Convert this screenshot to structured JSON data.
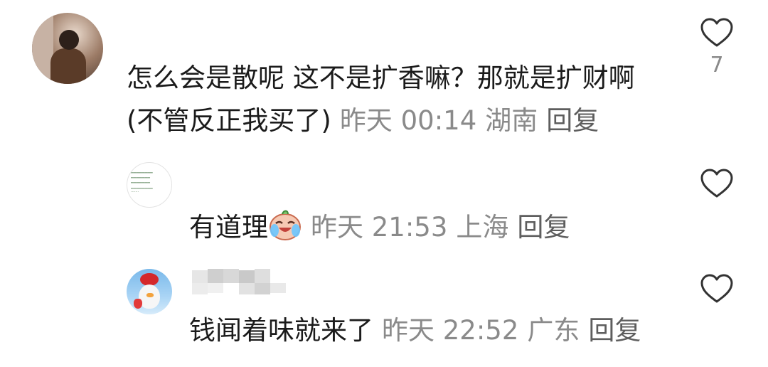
{
  "comments": [
    {
      "text": "怎么会是散呢 这不是扩香嘛？那就是扩财啊 (不管反正我买了)",
      "time": "昨天 00:14",
      "location": "湖南",
      "reply_label": "回复",
      "like_count": "7",
      "like_icon": "heart-outline-icon"
    }
  ],
  "replies": [
    {
      "text": "有道理",
      "sticker": "laughing-crying-emoji",
      "time": "昨天 21:53",
      "location": "上海",
      "reply_label": "回复",
      "like_icon": "heart-outline-icon"
    },
    {
      "text": "钱闻着味就来了",
      "time": "昨天 22:52",
      "location": "广东",
      "reply_label": "回复",
      "like_icon": "heart-outline-icon"
    }
  ],
  "colors": {
    "text": "#1b1b1b",
    "meta": "#8a8a8a",
    "reply": "#5e5e5e",
    "icon_stroke": "#333333"
  }
}
